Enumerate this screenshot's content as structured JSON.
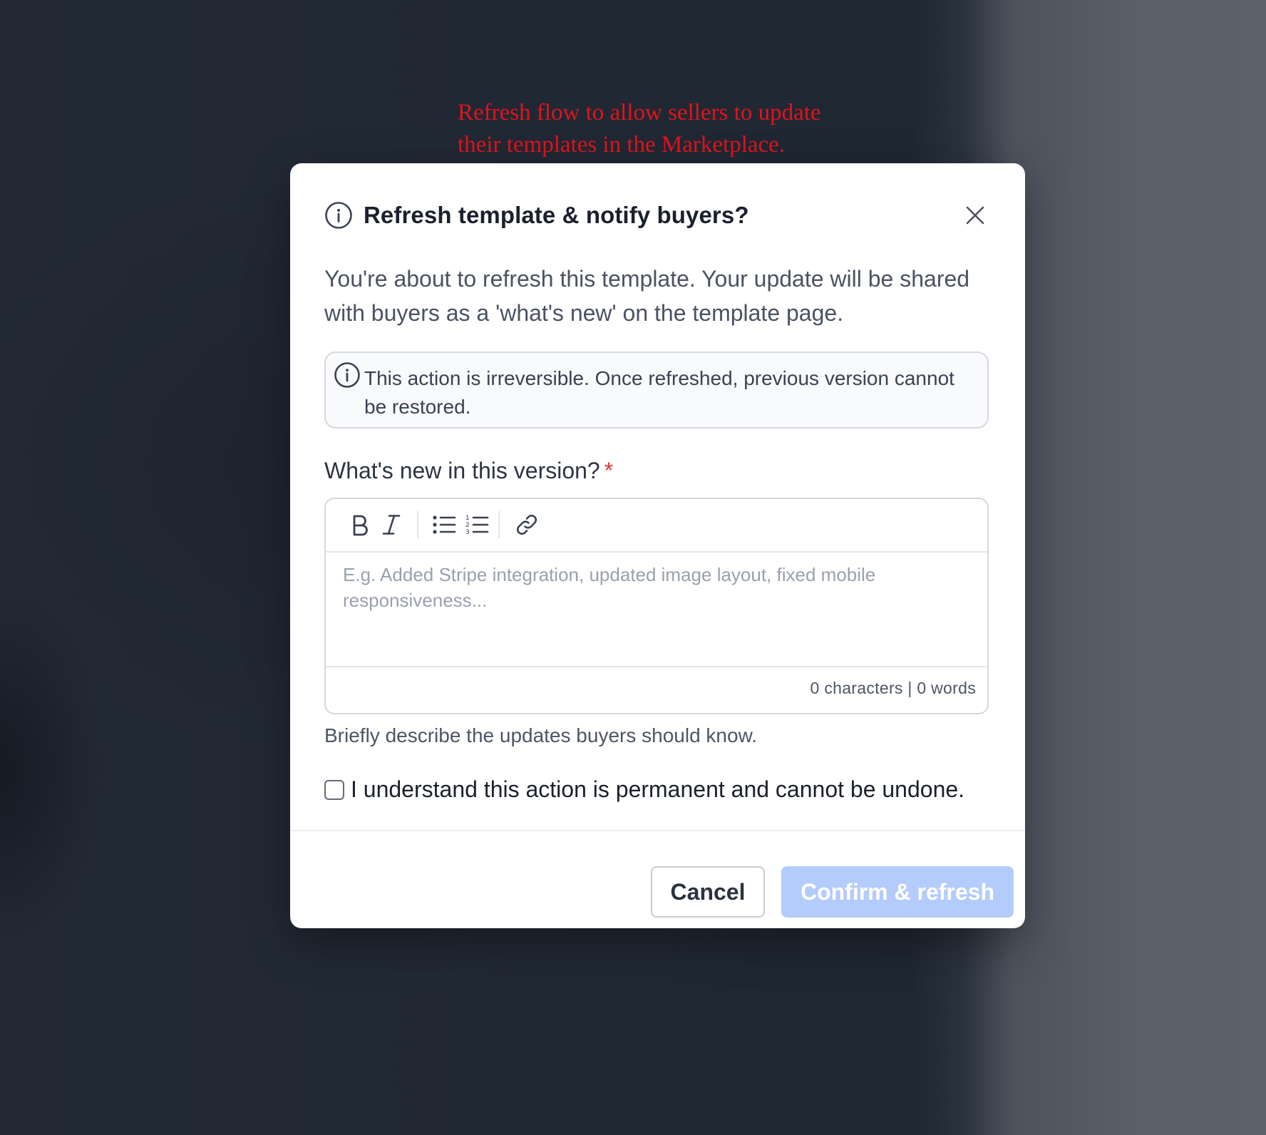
{
  "annotation": {
    "line1": "Refresh flow to allow sellers to update",
    "line2": "their templates in the Marketplace."
  },
  "modal": {
    "title": "Refresh template & notify buyers?",
    "title_icon": "info-icon",
    "close_icon": "close-icon",
    "description": "You're about to refresh this template. Your update will be shared with buyers as a 'what's new' on the template page.",
    "alert": {
      "icon": "info-icon",
      "text": "This action is irreversible. Once refreshed, previous version cannot be restored."
    },
    "field": {
      "label": "What's new in this version?",
      "required_mark": "*",
      "toolbar": [
        "bold-icon",
        "italic-icon",
        "bullet-list-icon",
        "numbered-list-icon",
        "link-icon"
      ],
      "placeholder": "E.g. Added Stripe integration, updated image layout, fixed mobile responsiveness...",
      "counter": "0 characters | 0 words",
      "helper": "Briefly describe the updates buyers should know."
    },
    "confirmation": {
      "checked": false,
      "label": "I understand this action is permanent and cannot be undone."
    },
    "buttons": {
      "cancel": "Cancel",
      "confirm": "Confirm & refresh",
      "confirm_disabled": true
    }
  },
  "colors": {
    "annotation": "#e0141c",
    "confirm_disabled_bg": "#b4ccfc",
    "required": "#e0353a"
  }
}
